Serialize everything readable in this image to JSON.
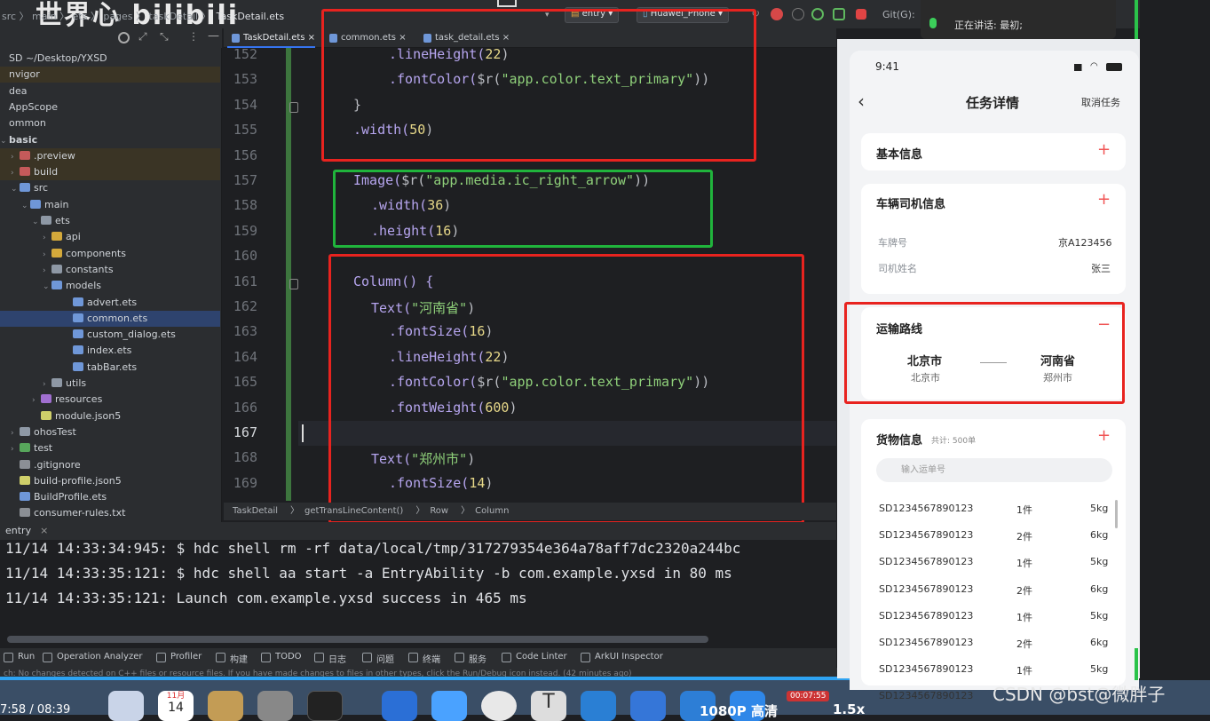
{
  "topbar": {
    "breadcrumb": "src 〉 main 〉 ets 〉 pages 〉 taskDetail 〉",
    "file": "TaskDetail.ets",
    "watermark": "世界心 bilibili",
    "run_config": "entry",
    "device": "Huawei_Phone",
    "git_label": "Git(G):"
  },
  "notice": {
    "speaking": "正在讲话:",
    "name": "最初;"
  },
  "sidebar": {
    "items": [
      {
        "label": "SD ~/Desktop/YXSD",
        "indent": 0,
        "arrow": "",
        "icon": "none",
        "state": ""
      },
      {
        "label": "nvigor",
        "indent": 0,
        "arrow": "",
        "icon": "none",
        "state": "hl"
      },
      {
        "label": "dea",
        "indent": 0,
        "arrow": "",
        "icon": "none",
        "state": ""
      },
      {
        "label": "AppScope",
        "indent": 0,
        "arrow": "",
        "icon": "none",
        "state": ""
      },
      {
        "label": "ommon",
        "indent": 0,
        "arrow": "",
        "icon": "none",
        "state": ""
      },
      {
        "label": "basic",
        "indent": 0,
        "arrow": "⌄",
        "icon": "none",
        "state": ""
      },
      {
        "label": ".preview",
        "indent": 1,
        "arrow": "›",
        "icon": "folder-red",
        "state": "hl"
      },
      {
        "label": "build",
        "indent": 1,
        "arrow": "›",
        "icon": "folder-red",
        "state": "hl"
      },
      {
        "label": "src",
        "indent": 1,
        "arrow": "⌄",
        "icon": "folder-blue",
        "state": ""
      },
      {
        "label": "main",
        "indent": 2,
        "arrow": "⌄",
        "icon": "folder-blue",
        "state": ""
      },
      {
        "label": "ets",
        "indent": 3,
        "arrow": "⌄",
        "icon": "folder",
        "state": ""
      },
      {
        "label": "api",
        "indent": 4,
        "arrow": "›",
        "icon": "folder-yellow",
        "state": ""
      },
      {
        "label": "components",
        "indent": 4,
        "arrow": "›",
        "icon": "folder-yellow",
        "state": ""
      },
      {
        "label": "constants",
        "indent": 4,
        "arrow": "›",
        "icon": "folder",
        "state": ""
      },
      {
        "label": "models",
        "indent": 4,
        "arrow": "⌄",
        "icon": "folder-blue",
        "state": ""
      },
      {
        "label": "advert.ets",
        "indent": 6,
        "arrow": "",
        "icon": "file",
        "state": ""
      },
      {
        "label": "common.ets",
        "indent": 6,
        "arrow": "",
        "icon": "file",
        "state": "sel"
      },
      {
        "label": "custom_dialog.ets",
        "indent": 6,
        "arrow": "",
        "icon": "file",
        "state": ""
      },
      {
        "label": "index.ets",
        "indent": 6,
        "arrow": "",
        "icon": "file",
        "state": ""
      },
      {
        "label": "tabBar.ets",
        "indent": 6,
        "arrow": "",
        "icon": "file",
        "state": ""
      },
      {
        "label": "utils",
        "indent": 4,
        "arrow": "›",
        "icon": "folder",
        "state": ""
      },
      {
        "label": "resources",
        "indent": 3,
        "arrow": "›",
        "icon": "folder-purple",
        "state": ""
      },
      {
        "label": "module.json5",
        "indent": 3,
        "arrow": "",
        "icon": "json",
        "state": ""
      },
      {
        "label": "ohosTest",
        "indent": 1,
        "arrow": "›",
        "icon": "folder",
        "state": ""
      },
      {
        "label": "test",
        "indent": 1,
        "arrow": "›",
        "icon": "folder-green",
        "state": ""
      },
      {
        "label": ".gitignore",
        "indent": 1,
        "arrow": "",
        "icon": "file-grey",
        "state": ""
      },
      {
        "label": "build-profile.json5",
        "indent": 1,
        "arrow": "",
        "icon": "json",
        "state": ""
      },
      {
        "label": "BuildProfile.ets",
        "indent": 1,
        "arrow": "",
        "icon": "file",
        "state": ""
      },
      {
        "label": "consumer-rules.txt",
        "indent": 1,
        "arrow": "",
        "icon": "file-grey",
        "state": ""
      }
    ]
  },
  "tabs": [
    {
      "label": "TaskDetail.ets ×",
      "active": true
    },
    {
      "label": "common.ets ×",
      "active": false
    },
    {
      "label": "task_detail.ets ×",
      "active": false
    }
  ],
  "editor": {
    "current_line": 167,
    "lines": [
      {
        "no": 152,
        "indent": 5,
        "tokens": [
          {
            "t": ".lineHeight(",
            "c": "fn"
          },
          {
            "t": "22",
            "c": "num"
          },
          {
            "t": ")",
            "c": "p"
          }
        ]
      },
      {
        "no": 153,
        "indent": 5,
        "tokens": [
          {
            "t": ".fontColor(",
            "c": "fn"
          },
          {
            "t": "$r(",
            "c": "p"
          },
          {
            "t": "\"app.color.text_primary\"",
            "c": "str"
          },
          {
            "t": "))",
            "c": "p"
          }
        ]
      },
      {
        "no": 154,
        "indent": 3,
        "tokens": [
          {
            "t": "}",
            "c": "p"
          }
        ]
      },
      {
        "no": 155,
        "indent": 3,
        "tokens": [
          {
            "t": ".width(",
            "c": "fn"
          },
          {
            "t": "50",
            "c": "num"
          },
          {
            "t": ")",
            "c": "p"
          }
        ]
      },
      {
        "no": 156,
        "indent": 0,
        "tokens": []
      },
      {
        "no": 157,
        "indent": 3,
        "tokens": [
          {
            "t": "Image(",
            "c": "fn"
          },
          {
            "t": "$r(",
            "c": "p"
          },
          {
            "t": "\"app.media.ic_right_arrow\"",
            "c": "str"
          },
          {
            "t": "))",
            "c": "p"
          }
        ]
      },
      {
        "no": 158,
        "indent": 4,
        "tokens": [
          {
            "t": ".width(",
            "c": "fn"
          },
          {
            "t": "36",
            "c": "num"
          },
          {
            "t": ")",
            "c": "p"
          }
        ]
      },
      {
        "no": 159,
        "indent": 4,
        "tokens": [
          {
            "t": ".height(",
            "c": "fn"
          },
          {
            "t": "16",
            "c": "num"
          },
          {
            "t": ")",
            "c": "p"
          }
        ]
      },
      {
        "no": 160,
        "indent": 0,
        "tokens": []
      },
      {
        "no": 161,
        "indent": 3,
        "tokens": [
          {
            "t": "Column() {",
            "c": "fn"
          }
        ]
      },
      {
        "no": 162,
        "indent": 4,
        "tokens": [
          {
            "t": "Text(",
            "c": "fn"
          },
          {
            "t": "\"河南省\"",
            "c": "str"
          },
          {
            "t": ")",
            "c": "p"
          }
        ]
      },
      {
        "no": 163,
        "indent": 5,
        "tokens": [
          {
            "t": ".fontSize(",
            "c": "fn"
          },
          {
            "t": "16",
            "c": "num"
          },
          {
            "t": ")",
            "c": "p"
          }
        ]
      },
      {
        "no": 164,
        "indent": 5,
        "tokens": [
          {
            "t": ".lineHeight(",
            "c": "fn"
          },
          {
            "t": "22",
            "c": "num"
          },
          {
            "t": ")",
            "c": "p"
          }
        ]
      },
      {
        "no": 165,
        "indent": 5,
        "tokens": [
          {
            "t": ".fontColor(",
            "c": "fn"
          },
          {
            "t": "$r(",
            "c": "p"
          },
          {
            "t": "\"app.color.text_primary\"",
            "c": "str"
          },
          {
            "t": "))",
            "c": "p"
          }
        ]
      },
      {
        "no": 166,
        "indent": 5,
        "tokens": [
          {
            "t": ".fontWeight(",
            "c": "fn"
          },
          {
            "t": "600",
            "c": "num"
          },
          {
            "t": ")",
            "c": "p"
          }
        ]
      },
      {
        "no": 167,
        "indent": 0,
        "tokens": []
      },
      {
        "no": 168,
        "indent": 4,
        "tokens": [
          {
            "t": "Text(",
            "c": "fn"
          },
          {
            "t": "\"郑州市\"",
            "c": "str"
          },
          {
            "t": ")",
            "c": "p"
          }
        ]
      },
      {
        "no": 169,
        "indent": 5,
        "tokens": [
          {
            "t": ".fontSize(",
            "c": "fn"
          },
          {
            "t": "14",
            "c": "num"
          },
          {
            "t": ")",
            "c": "p"
          }
        ]
      }
    ]
  },
  "colors": {
    "fn": "#b7a6f0",
    "num": "#e7d889",
    "str": "#8fd07a",
    "p": "#bcbec4",
    "red_box": "#e8231f",
    "green_box": "#20b43c"
  },
  "status_breadcrumb": [
    "TaskDetail",
    "getTransLineContent()",
    "Row",
    "Column"
  ],
  "run": {
    "label": "entry",
    "lines": [
      "11/14 14:33:34:945: $ hdc shell rm -rf data/local/tmp/317279354e364a78aff7dc2320a244bc",
      "11/14 14:33:35:121: $ hdc shell aa start -a EntryAbility -b com.example.yxsd in 80 ms",
      "11/14 14:33:35:121: Launch com.example.yxsd success in 465 ms"
    ]
  },
  "toolstrip": [
    "Run",
    "Operation Analyzer",
    "Profiler",
    "构建",
    "TODO",
    "日志",
    "问题",
    "终端",
    "服务",
    "Code Linter",
    "ArkUI Inspector"
  ],
  "message": "ch: No changes detected on C++ files or resource files. If you have made changes to files in other types, click the Run/Debug icon instead. (42 minutes ago)",
  "phone": {
    "time": "9:41",
    "nav_title": "任务详情",
    "nav_action": "取消任务",
    "basic_info": "基本信息",
    "vehicle_info": "车辆司机信息",
    "plate_label": "车牌号",
    "plate_value": "京A123456",
    "driver_label": "司机姓名",
    "driver_value": "张三",
    "route_title": "运输路线",
    "from_city": "北京市",
    "from_sub": "北京市",
    "to_city": "河南省",
    "to_sub": "郑州市",
    "goods_title": "货物信息",
    "goods_total": "共计: 500单",
    "search_placeholder": "输入运单号",
    "goods": [
      {
        "id": "SD1234567890123",
        "qty": "1件",
        "weight": "5kg"
      },
      {
        "id": "SD1234567890123",
        "qty": "2件",
        "weight": "6kg"
      },
      {
        "id": "SD1234567890123",
        "qty": "1件",
        "weight": "5kg"
      },
      {
        "id": "SD1234567890123",
        "qty": "2件",
        "weight": "6kg"
      },
      {
        "id": "SD1234567890123",
        "qty": "1件",
        "weight": "5kg"
      },
      {
        "id": "SD1234567890123",
        "qty": "2件",
        "weight": "6kg"
      },
      {
        "id": "SD1234567890123",
        "qty": "1件",
        "weight": "5kg"
      },
      {
        "id": "SD1234567890123",
        "qty": "",
        "weight": ""
      }
    ]
  },
  "video": {
    "time": "7:58 / 08:39",
    "quality": "1080P 高清",
    "speed": "1.5x",
    "watermark": "CSDN @bst@微胖子",
    "badge": "00:07:55",
    "cal_month": "11月",
    "cal_day": "14"
  }
}
